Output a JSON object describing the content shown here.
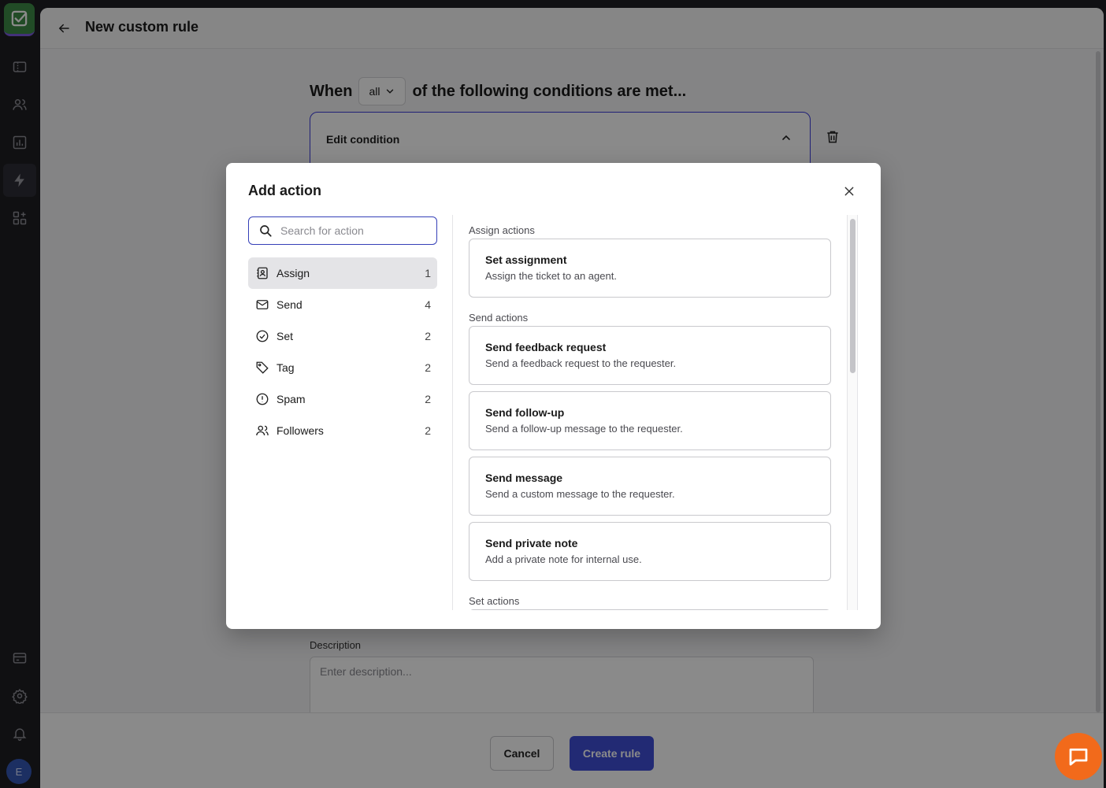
{
  "app": {
    "avatar_initial": "E",
    "accent_color": "#3f4fd6",
    "brand_color": "#3d8b46"
  },
  "sidebar": {
    "items": [
      {
        "icon": "ticket-icon"
      },
      {
        "icon": "users-icon"
      },
      {
        "icon": "bar-chart-icon"
      },
      {
        "icon": "lightning-icon",
        "active": true
      },
      {
        "icon": "grid-plus-icon"
      },
      {
        "icon": "credit-card-icon"
      },
      {
        "icon": "gear-icon"
      },
      {
        "icon": "bell-icon"
      }
    ]
  },
  "header": {
    "title": "New custom rule"
  },
  "rule": {
    "when_prefix": "When",
    "match_value": "all",
    "when_suffix": "of the following conditions are met...",
    "edit_condition_label": "Edit condition",
    "description_label": "Description",
    "description_placeholder": "Enter description..."
  },
  "footer": {
    "cancel_label": "Cancel",
    "create_label": "Create rule"
  },
  "modal": {
    "title": "Add action",
    "search_placeholder": "Search for action",
    "categories": [
      {
        "label": "Assign",
        "count": "1",
        "icon": "contact-book-icon",
        "active": true
      },
      {
        "label": "Send",
        "count": "4",
        "icon": "envelope-icon"
      },
      {
        "label": "Set",
        "count": "2",
        "icon": "check-circle-icon"
      },
      {
        "label": "Tag",
        "count": "2",
        "icon": "tag-icon"
      },
      {
        "label": "Spam",
        "count": "2",
        "icon": "alert-circle-icon"
      },
      {
        "label": "Followers",
        "count": "2",
        "icon": "users-icon"
      }
    ],
    "sections": [
      {
        "title": "Assign actions",
        "actions": [
          {
            "title": "Set assignment",
            "description": "Assign the ticket to an agent."
          }
        ]
      },
      {
        "title": "Send actions",
        "actions": [
          {
            "title": "Send feedback request",
            "description": "Send a feedback request to the requester."
          },
          {
            "title": "Send follow-up",
            "description": "Send a follow-up message to the requester."
          },
          {
            "title": "Send message",
            "description": "Send a custom message to the requester."
          },
          {
            "title": "Send private note",
            "description": "Add a private note for internal use."
          }
        ]
      },
      {
        "title": "Set actions",
        "actions": []
      }
    ]
  }
}
